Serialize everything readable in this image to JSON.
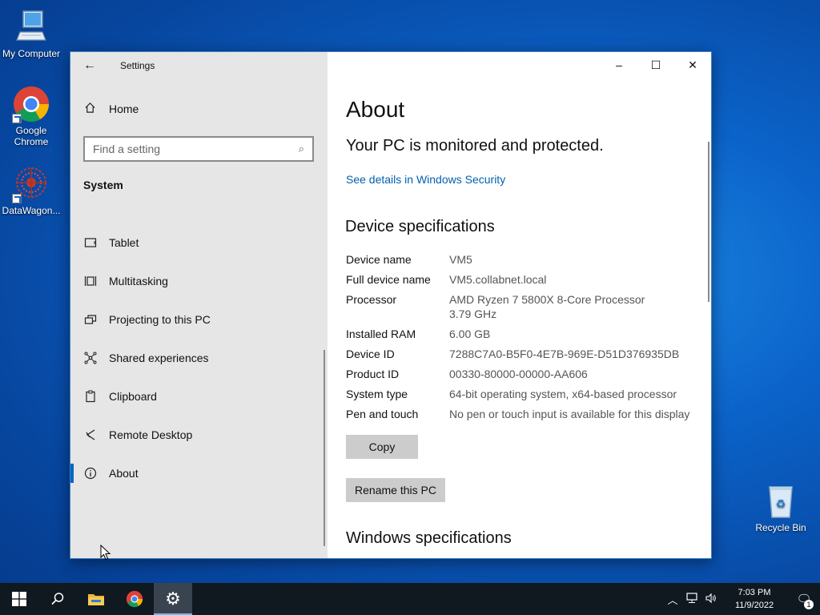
{
  "desktop": {
    "icons": [
      {
        "label": "My Computer"
      },
      {
        "label": "Google Chrome"
      },
      {
        "label": "DataWagon..."
      },
      {
        "label": "Recycle Bin"
      }
    ]
  },
  "window": {
    "title": "Settings",
    "back_icon": "back-arrow-icon",
    "controls": {
      "minimize": "–",
      "maximize": "☐",
      "close": "✕"
    }
  },
  "sidebar": {
    "home_label": "Home",
    "search_placeholder": "Find a setting",
    "section_label": "System",
    "items": [
      {
        "label": "Tablet",
        "icon": "tablet-icon"
      },
      {
        "label": "Multitasking",
        "icon": "multitasking-icon"
      },
      {
        "label": "Projecting to this PC",
        "icon": "projecting-icon"
      },
      {
        "label": "Shared experiences",
        "icon": "shared-experiences-icon"
      },
      {
        "label": "Clipboard",
        "icon": "clipboard-icon"
      },
      {
        "label": "Remote Desktop",
        "icon": "remote-desktop-icon"
      },
      {
        "label": "About",
        "icon": "info-icon",
        "active": true
      }
    ]
  },
  "content": {
    "page_title": "About",
    "protection_status": "Your PC is monitored and protected.",
    "security_link": "See details in Windows Security",
    "device_spec_heading": "Device specifications",
    "specs": [
      {
        "key": "Device name",
        "value": "VM5"
      },
      {
        "key": "Full device name",
        "value": "VM5.collabnet.local"
      },
      {
        "key": "Processor",
        "value": "AMD Ryzen 7 5800X 8-Core Processor",
        "value2": "3.79 GHz"
      },
      {
        "key": "Installed RAM",
        "value": "6.00 GB"
      },
      {
        "key": "Device ID",
        "value": "7288C7A0-B5F0-4E7B-969E-D51D376935DB"
      },
      {
        "key": "Product ID",
        "value": "00330-80000-00000-AA606"
      },
      {
        "key": "System type",
        "value": "64-bit operating system, x64-based processor"
      },
      {
        "key": "Pen and touch",
        "value": "No pen or touch input is available for this display"
      }
    ],
    "copy_button": "Copy",
    "rename_button": "Rename this PC",
    "windows_spec_heading": "Windows specifications"
  },
  "taskbar": {
    "time": "7:03 PM",
    "date": "11/9/2022",
    "notification_count": "1"
  }
}
